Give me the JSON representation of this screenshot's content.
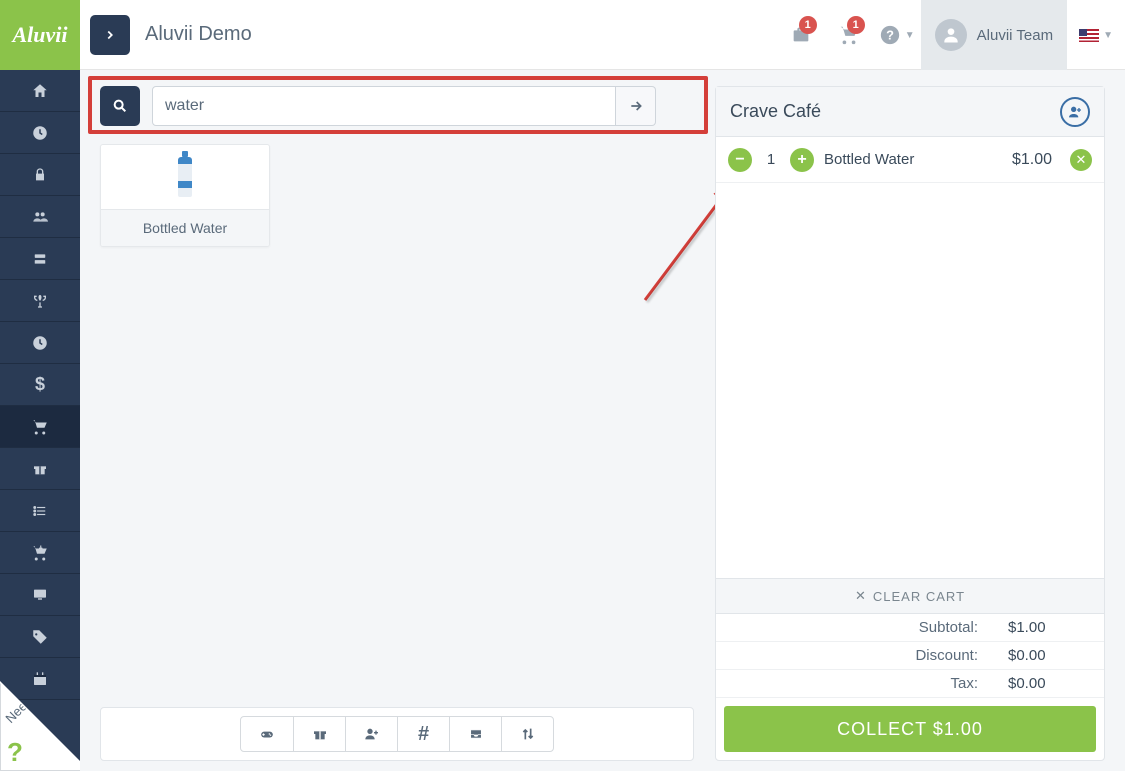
{
  "brand": "Aluvii",
  "header": {
    "page_title": "Aluvii Demo",
    "briefcase_badge": "1",
    "cart_badge": "1",
    "user_name": "Aluvii Team"
  },
  "sidebar": {
    "items": [
      "home",
      "clock",
      "lock",
      "users",
      "server",
      "trophy",
      "time",
      "dollar",
      "cart",
      "gift",
      "list",
      "cart-down",
      "monitor",
      "tag",
      "calendar"
    ]
  },
  "search": {
    "value": "water"
  },
  "products": [
    {
      "name": "Bottled Water"
    }
  ],
  "cart": {
    "title": "Crave Café",
    "items": [
      {
        "qty": "1",
        "name": "Bottled Water",
        "price": "$1.00"
      }
    ],
    "clear_label": "CLEAR CART",
    "subtotal_label": "Subtotal:",
    "subtotal_value": "$1.00",
    "discount_label": "Discount:",
    "discount_value": "$0.00",
    "tax_label": "Tax:",
    "tax_value": "$0.00",
    "collect_label": "COLLECT $1.00"
  },
  "need_help": "Need Help"
}
